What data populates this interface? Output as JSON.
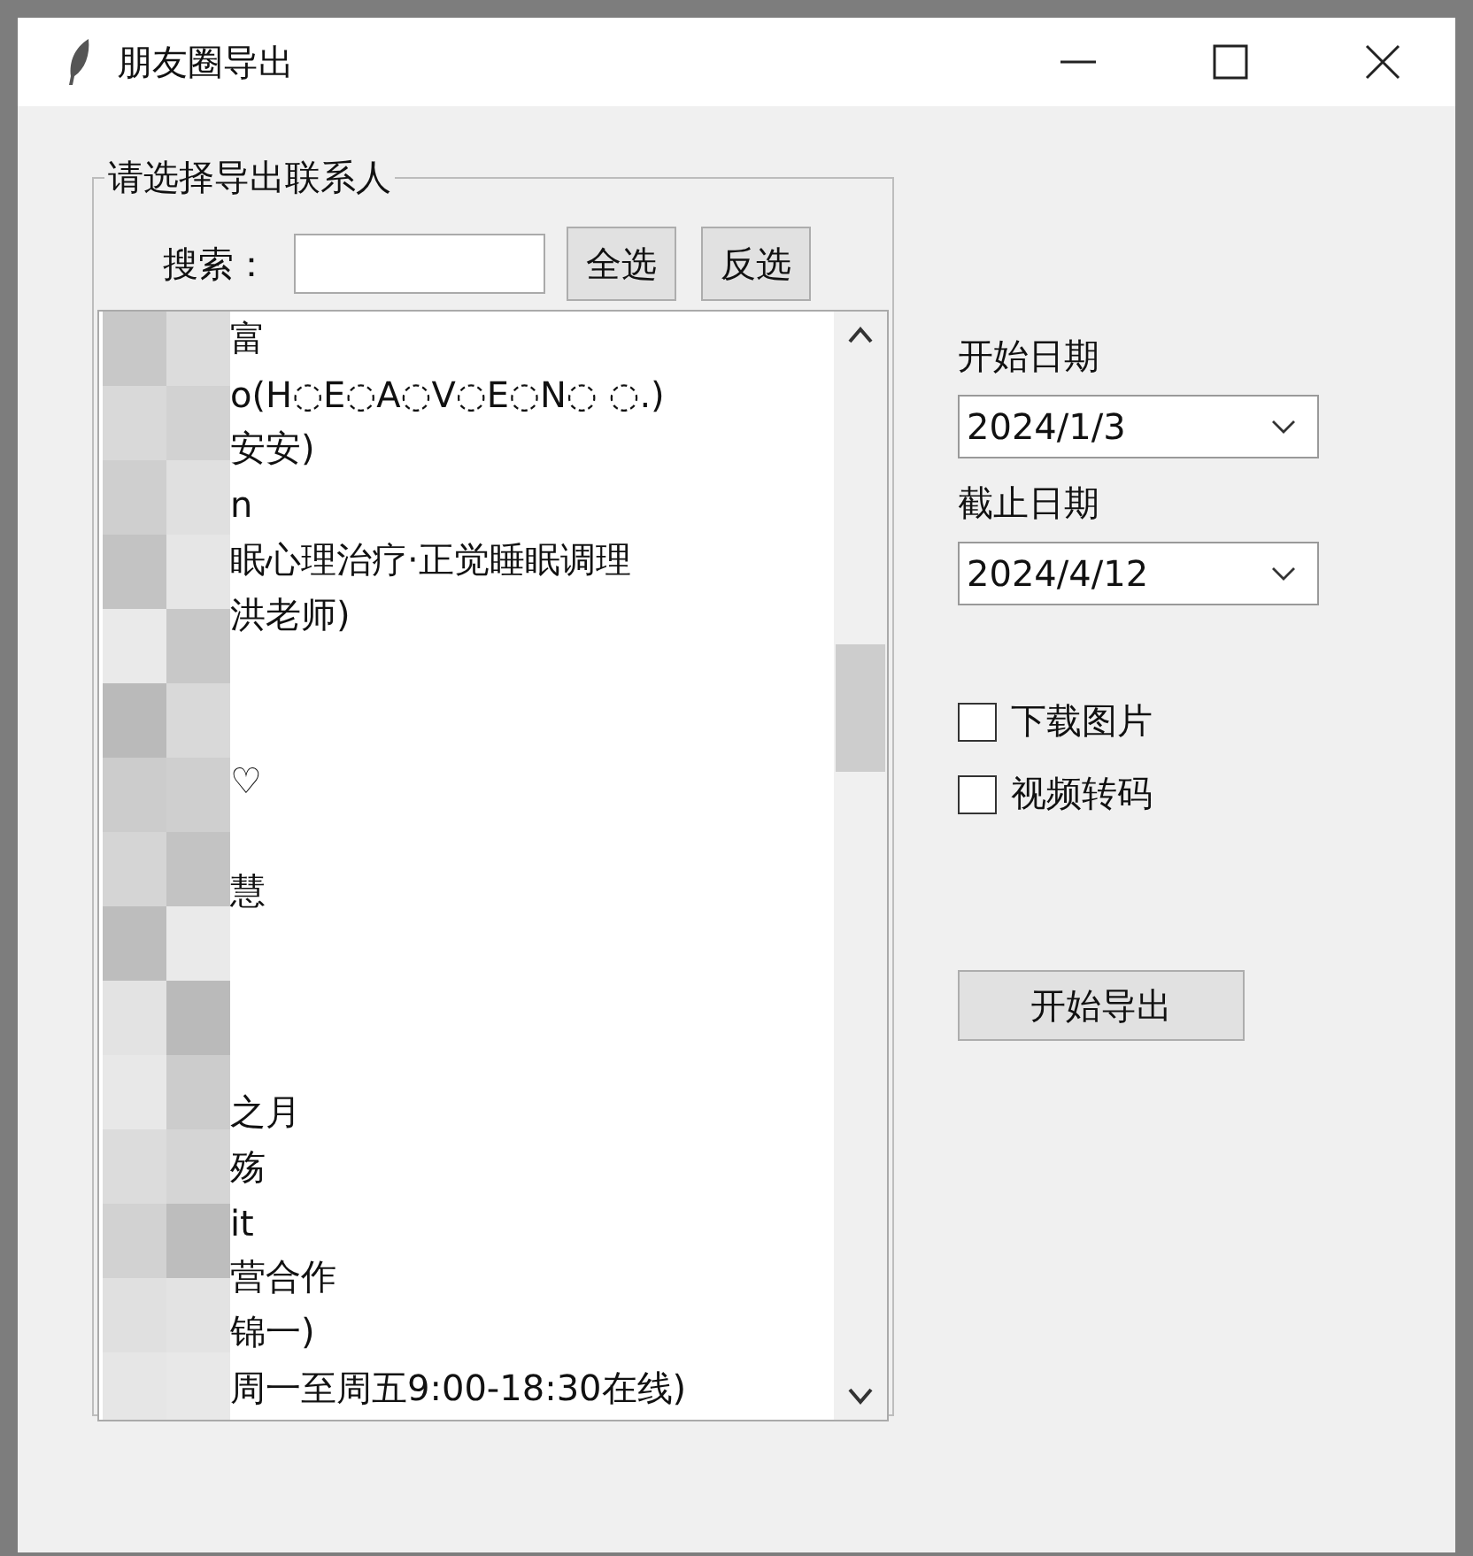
{
  "window": {
    "title": "朋友圈导出"
  },
  "contacts": {
    "label": "请选择导出联系人",
    "search_label": "搜索：",
    "buttons": [
      "全选",
      "反选"
    ],
    "items": [
      {
        "text": "富",
        "selected": false
      },
      {
        "text": "o(H◌E◌A◌V◌E◌N◌ ◌.)",
        "selected": false
      },
      {
        "text": "安安)",
        "selected": false
      },
      {
        "text": "n",
        "selected": false
      },
      {
        "text": "眠心理治疗·正觉睡眠调理",
        "selected": false
      },
      {
        "text": "洪老师)",
        "selected": false
      },
      {
        "selected": false
      },
      {
        "selected": false
      },
      {
        "text": "♡",
        "selected": false
      },
      {
        "selected": false
      },
      {
        "text": "慧",
        "selected": false
      },
      {
        "selected": false
      },
      {
        "selected": false
      },
      {
        "selected": false
      },
      {
        "text": "之月",
        "selected": false
      },
      {
        "text": "殇",
        "selected": false
      },
      {
        "text": "it",
        "selected": false
      },
      {
        "text": "营合作",
        "selected": false
      },
      {
        "text": "锦一)",
        "selected": false
      },
      {
        "text": "周一至周五9:00-18:30在线)",
        "selected": false
      }
    ]
  },
  "start_date": {
    "label": "开始日期",
    "value": "2024/1/3"
  },
  "end_date": {
    "label": "截止日期",
    "value": "2024/4/12"
  },
  "options": [
    {
      "label": "下载图片",
      "checked": false
    },
    {
      "label": "视频转码",
      "checked": false
    }
  ],
  "export_button": "开始导出"
}
